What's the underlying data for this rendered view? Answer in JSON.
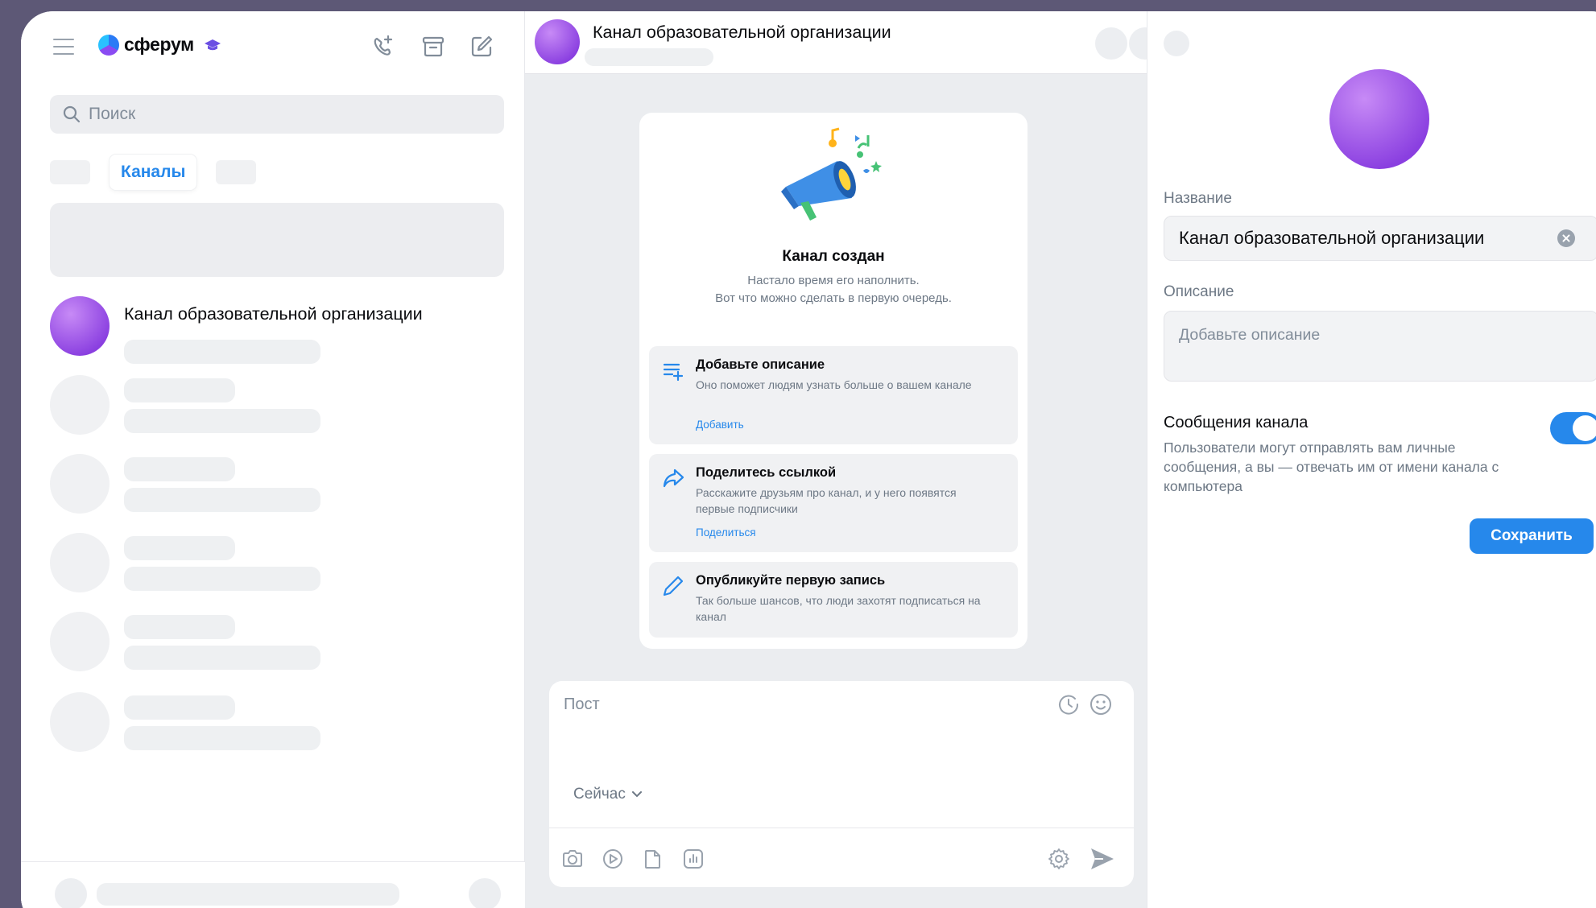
{
  "app": {
    "logo_text": "сферум"
  },
  "sidebar": {
    "search_placeholder": "Поиск",
    "active_tab": "Каналы",
    "chat": {
      "title": "Канал образовательной организации"
    }
  },
  "channel": {
    "header_title": "Канал образовательной организации",
    "card": {
      "title": "Канал создан",
      "subtitle_line1": "Настало время его наполнить.",
      "subtitle_line2": "Вот что можно сделать в первую очередь.",
      "steps": [
        {
          "icon": "add-list-icon",
          "title": "Добавьте описание",
          "text": "Оно поможет людям узнать больше о вашем канале",
          "link": "Добавить"
        },
        {
          "icon": "share-icon",
          "title": "Поделитесь ссылкой",
          "text": "Расскажите друзьям про канал, и у него появятся первые подписчики",
          "link": "Поделиться"
        },
        {
          "icon": "pencil-icon",
          "title": "Опубликуйте первую запись",
          "text": "Так больше шансов, что люди захотят подписаться на канал"
        }
      ]
    },
    "composer": {
      "placeholder": "Пост",
      "schedule": "Сейчас"
    }
  },
  "settings": {
    "name_label": "Название",
    "name_value": "Канал образовательной организации",
    "description_label": "Описание",
    "description_placeholder": "Добавьте описание",
    "messages_title": "Сообщения канала",
    "messages_text": "Пользователи могут отправлять вам личные сообщения, а вы — отвечать им от имени канала с компьютера",
    "messages_enabled": true,
    "save_label": "Сохранить"
  },
  "colors": {
    "accent": "#2688eb",
    "backdrop": "#5d5876",
    "avatar": "#a35cec"
  }
}
